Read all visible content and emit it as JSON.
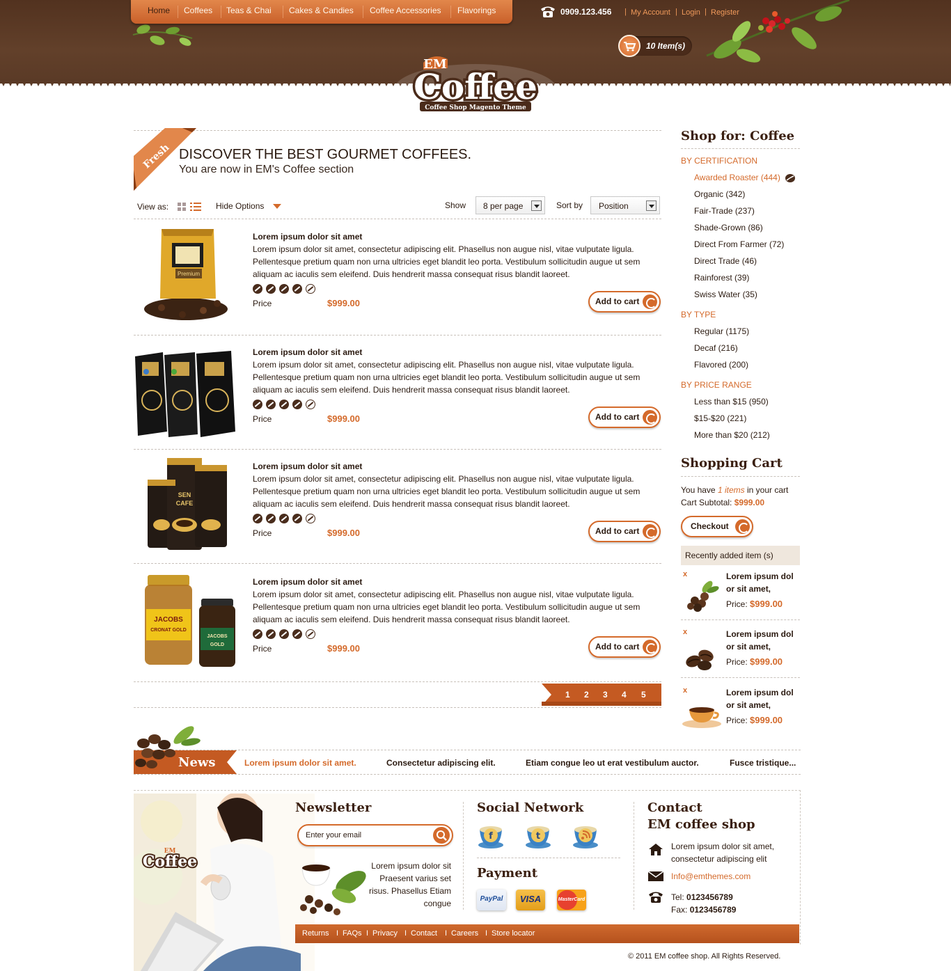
{
  "header": {
    "nav": [
      "Home",
      "Coffees",
      "Teas & Chai",
      "Cakes & Candies",
      "Coffee Accessories",
      "Flavorings"
    ],
    "phone": "0909.123.456",
    "top_links": [
      "My Account",
      "Login",
      "Register"
    ],
    "cart_items": "10 Item(s)",
    "logo": {
      "top": "EM",
      "main": "Coffee",
      "tagline": "Coffee Shop Magento Theme"
    }
  },
  "category": {
    "ribbon": "Fresh",
    "headline": "DISCOVER THE BEST GOURMET COFFEES.",
    "subline": "You are now in EM's Coffee section"
  },
  "toolbar": {
    "view_as": "View as:",
    "hide_options": "Hide Options",
    "show_label": "Show",
    "per_page": "8 per page",
    "sort_label": "Sort by",
    "sort_value": "Position"
  },
  "products": [
    {
      "title": "Lorem ipsum dolor sit amet",
      "desc": "Lorem ipsum dolor sit amet, consectetur adipiscing elit. Phasellus non augue nisl, vitae vulputate ligula. Pellentesque pretium quam non urna ultricies eget blandit leo porta. Vestibulum sollicitudin augue ut sem aliquam ac iaculis sem eleifend. Duis hendrerit massa consequat risus blandit laoreet.",
      "rating": 4,
      "price_label": "Price",
      "price": "$999.00",
      "button": "Add to cart"
    },
    {
      "title": "Lorem ipsum dolor sit amet",
      "desc": "Lorem ipsum dolor sit amet, consectetur adipiscing elit. Phasellus non augue nisl, vitae vulputate ligula. Pellentesque pretium quam non urna ultricies eget blandit leo porta. Vestibulum sollicitudin augue ut sem aliquam ac iaculis sem eleifend. Duis hendrerit massa consequat risus blandit laoreet.",
      "rating": 4,
      "price_label": "Price",
      "price": "$999.00",
      "button": "Add to cart"
    },
    {
      "title": "Lorem ipsum dolor sit amet",
      "desc": "Lorem ipsum dolor sit amet, consectetur adipiscing elit. Phasellus non augue nisl, vitae vulputate ligula. Pellentesque pretium quam non urna ultricies eget blandit leo porta. Vestibulum sollicitudin augue ut sem aliquam ac iaculis sem eleifend. Duis hendrerit massa consequat risus blandit laoreet.",
      "rating": 4,
      "price_label": "Price",
      "price": "$999.00",
      "button": "Add to cart"
    },
    {
      "title": "Lorem ipsum dolor sit amet",
      "desc": "Lorem ipsum dolor sit amet, consectetur adipiscing elit. Phasellus non augue nisl, vitae vulputate ligula. Pellentesque pretium quam non urna ultricies eget blandit leo porta. Vestibulum sollicitudin augue ut sem aliquam ac iaculis sem eleifend. Duis hendrerit massa consequat risus blandit laoreet.",
      "rating": 4,
      "price_label": "Price",
      "price": "$999.00",
      "button": "Add to cart"
    }
  ],
  "pagination": [
    "1",
    "2",
    "3",
    "4",
    "5"
  ],
  "sidebar": {
    "shop_for": "Shop for: Coffee",
    "groups": [
      {
        "title": "BY CERTIFICATION",
        "items": [
          "Awarded Roaster (444)",
          "Organic (342)",
          "Fair-Trade (237)",
          "Shade-Grown (86)",
          "Direct From Farmer (72)",
          "Direct Trade (46)",
          "Rainforest (39)",
          "Swiss Water (35)"
        ]
      },
      {
        "title": "BY TYPE",
        "items": [
          "Regular (1175)",
          "Decaf (216)",
          "Flavored (200)"
        ]
      },
      {
        "title": "BY PRICE RANGE",
        "items": [
          "Less than $15 (950)",
          "$15-$20 (221)",
          "More than $20 (212)"
        ]
      }
    ],
    "cart": {
      "title": "Shopping Cart",
      "you_have": "You have",
      "items_count": "1 items",
      "in_cart": "in your cart",
      "subtotal_label": "Cart Subtotal:",
      "subtotal": "$999.00",
      "checkout": "Checkout",
      "recent_title": "Recently added item (s)",
      "recent": [
        {
          "remove": "x",
          "title": "Lorem ipsum dol or sit amet,",
          "price_label": "Price:",
          "price": "$999.00"
        },
        {
          "remove": "x",
          "title": "Lorem ipsum dol or sit amet,",
          "price_label": "Price:",
          "price": "$999.00"
        },
        {
          "remove": "x",
          "title": "Lorem ipsum dol or sit amet,",
          "price_label": "Price:",
          "price": "$999.00"
        }
      ]
    }
  },
  "news": {
    "label": "News",
    "items": [
      "Lorem ipsum dolor sit amet.",
      "Consectetur adipiscing elit.",
      "Etiam congue leo ut erat vestibulum auctor.",
      "Fusce tristique..."
    ]
  },
  "footer": {
    "newsletter_title": "Newsletter",
    "email_placeholder": "Enter your email",
    "newsletter_text": "Lorem ipsum dolor sit Praesent varius set risus. Phasellus Etiam congue",
    "social_title": "Social Network",
    "social": [
      "facebook-icon",
      "twitter-icon",
      "rss-icon"
    ],
    "payment_title": "Payment",
    "payments": [
      "PayPal",
      "VISA",
      "MasterCard"
    ],
    "contact_title_1": "Contact",
    "contact_title_2": "EM coffee shop",
    "address": "Lorem ipsum dolor sit amet, consectetur adipiscing elit",
    "email": "Info@emthemes.com",
    "tel_label": "Tel:",
    "tel": "0123456789",
    "fax_label": "Fax:",
    "fax": "0123456789",
    "links": [
      "Returns",
      "FAQs",
      "Privacy",
      "Contact",
      "Careers",
      "Store locator"
    ],
    "copyright": "© 2011 EM coffee shop. All Rights Reserved."
  },
  "colors": {
    "accent": "#d46a2b",
    "brown": "#5a3a26",
    "dark": "#3a1f10"
  }
}
